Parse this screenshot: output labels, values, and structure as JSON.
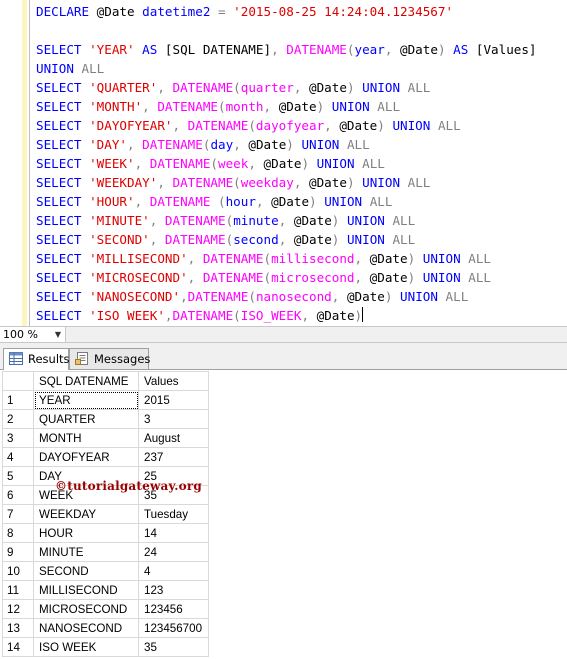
{
  "editor": {
    "lines": [
      [
        [
          "kw",
          "DECLARE "
        ],
        [
          "var",
          "@Date "
        ],
        [
          "kw",
          "datetime2 "
        ],
        [
          "op",
          "= "
        ],
        [
          "str",
          "'2015-08-25 14:24:04.1234567'"
        ]
      ],
      [],
      [
        [
          "kw",
          "SELECT "
        ],
        [
          "str",
          "'YEAR' "
        ],
        [
          "kw",
          "AS "
        ],
        [
          "plain",
          "[SQL DATENAME]"
        ],
        [
          "op",
          ", "
        ],
        [
          "fn",
          "DATENAME"
        ],
        [
          "op",
          "("
        ],
        [
          "kw",
          "year"
        ],
        [
          "op",
          ", "
        ],
        [
          "var",
          "@Date"
        ],
        [
          "op",
          ") "
        ],
        [
          "kw",
          "AS "
        ],
        [
          "plain",
          "[Values]"
        ]
      ],
      [
        [
          "kw",
          "UNION "
        ],
        [
          "op",
          "ALL"
        ]
      ],
      [
        [
          "kw",
          "SELECT "
        ],
        [
          "str",
          "'QUARTER'"
        ],
        [
          "op",
          ", "
        ],
        [
          "fn",
          "DATENAME"
        ],
        [
          "op",
          "("
        ],
        [
          "fn",
          "quarter"
        ],
        [
          "op",
          ", "
        ],
        [
          "var",
          "@Date"
        ],
        [
          "op",
          ") "
        ],
        [
          "kw",
          "UNION "
        ],
        [
          "op",
          "ALL"
        ]
      ],
      [
        [
          "kw",
          "SELECT "
        ],
        [
          "str",
          "'MONTH'"
        ],
        [
          "op",
          ", "
        ],
        [
          "fn",
          "DATENAME"
        ],
        [
          "op",
          "("
        ],
        [
          "fn",
          "month"
        ],
        [
          "op",
          ", "
        ],
        [
          "var",
          "@Date"
        ],
        [
          "op",
          ") "
        ],
        [
          "kw",
          "UNION "
        ],
        [
          "op",
          "ALL"
        ]
      ],
      [
        [
          "kw",
          "SELECT "
        ],
        [
          "str",
          "'DAYOFYEAR'"
        ],
        [
          "op",
          ", "
        ],
        [
          "fn",
          "DATENAME"
        ],
        [
          "op",
          "("
        ],
        [
          "fn",
          "dayofyear"
        ],
        [
          "op",
          ", "
        ],
        [
          "var",
          "@Date"
        ],
        [
          "op",
          ") "
        ],
        [
          "kw",
          "UNION "
        ],
        [
          "op",
          "ALL"
        ]
      ],
      [
        [
          "kw",
          "SELECT "
        ],
        [
          "str",
          "'DAY'"
        ],
        [
          "op",
          ", "
        ],
        [
          "fn",
          "DATENAME"
        ],
        [
          "op",
          "("
        ],
        [
          "kw",
          "day"
        ],
        [
          "op",
          ", "
        ],
        [
          "var",
          "@Date"
        ],
        [
          "op",
          ") "
        ],
        [
          "kw",
          "UNION "
        ],
        [
          "op",
          "ALL"
        ]
      ],
      [
        [
          "kw",
          "SELECT "
        ],
        [
          "str",
          "'WEEK'"
        ],
        [
          "op",
          ", "
        ],
        [
          "fn",
          "DATENAME"
        ],
        [
          "op",
          "("
        ],
        [
          "fn",
          "week"
        ],
        [
          "op",
          ", "
        ],
        [
          "var",
          "@Date"
        ],
        [
          "op",
          ") "
        ],
        [
          "kw",
          "UNION "
        ],
        [
          "op",
          "ALL"
        ]
      ],
      [
        [
          "kw",
          "SELECT "
        ],
        [
          "str",
          "'WEEKDAY'"
        ],
        [
          "op",
          ", "
        ],
        [
          "fn",
          "DATENAME"
        ],
        [
          "op",
          "("
        ],
        [
          "fn",
          "weekday"
        ],
        [
          "op",
          ", "
        ],
        [
          "var",
          "@Date"
        ],
        [
          "op",
          ") "
        ],
        [
          "kw",
          "UNION "
        ],
        [
          "op",
          "ALL"
        ]
      ],
      [
        [
          "kw",
          "SELECT "
        ],
        [
          "str",
          "'HOUR'"
        ],
        [
          "op",
          ", "
        ],
        [
          "fn",
          "DATENAME "
        ],
        [
          "op",
          "("
        ],
        [
          "kw",
          "hour"
        ],
        [
          "op",
          ", "
        ],
        [
          "var",
          "@Date"
        ],
        [
          "op",
          ") "
        ],
        [
          "kw",
          "UNION "
        ],
        [
          "op",
          "ALL"
        ]
      ],
      [
        [
          "kw",
          "SELECT "
        ],
        [
          "str",
          "'MINUTE'"
        ],
        [
          "op",
          ", "
        ],
        [
          "fn",
          "DATENAME"
        ],
        [
          "op",
          "("
        ],
        [
          "kw",
          "minute"
        ],
        [
          "op",
          ", "
        ],
        [
          "var",
          "@Date"
        ],
        [
          "op",
          ") "
        ],
        [
          "kw",
          "UNION "
        ],
        [
          "op",
          "ALL"
        ]
      ],
      [
        [
          "kw",
          "SELECT "
        ],
        [
          "str",
          "'SECOND'"
        ],
        [
          "op",
          ", "
        ],
        [
          "fn",
          "DATENAME"
        ],
        [
          "op",
          "("
        ],
        [
          "kw",
          "second"
        ],
        [
          "op",
          ", "
        ],
        [
          "var",
          "@Date"
        ],
        [
          "op",
          ") "
        ],
        [
          "kw",
          "UNION "
        ],
        [
          "op",
          "ALL"
        ]
      ],
      [
        [
          "kw",
          "SELECT "
        ],
        [
          "str",
          "'MILLISECOND'"
        ],
        [
          "op",
          ", "
        ],
        [
          "fn",
          "DATENAME"
        ],
        [
          "op",
          "("
        ],
        [
          "fn",
          "millisecond"
        ],
        [
          "op",
          ", "
        ],
        [
          "var",
          "@Date"
        ],
        [
          "op",
          ") "
        ],
        [
          "kw",
          "UNION "
        ],
        [
          "op",
          "ALL"
        ]
      ],
      [
        [
          "kw",
          "SELECT "
        ],
        [
          "str",
          "'MICROSECOND'"
        ],
        [
          "op",
          ", "
        ],
        [
          "fn",
          "DATENAME"
        ],
        [
          "op",
          "("
        ],
        [
          "fn",
          "microsecond"
        ],
        [
          "op",
          ", "
        ],
        [
          "var",
          "@Date"
        ],
        [
          "op",
          ") "
        ],
        [
          "kw",
          "UNION "
        ],
        [
          "op",
          "ALL"
        ]
      ],
      [
        [
          "kw",
          "SELECT "
        ],
        [
          "str",
          "'NANOSECOND'"
        ],
        [
          "op",
          ","
        ],
        [
          "fn",
          "DATENAME"
        ],
        [
          "op",
          "("
        ],
        [
          "fn",
          "nanosecond"
        ],
        [
          "op",
          ", "
        ],
        [
          "var",
          "@Date"
        ],
        [
          "op",
          ") "
        ],
        [
          "kw",
          "UNION "
        ],
        [
          "op",
          "ALL"
        ]
      ],
      [
        [
          "kw",
          "SELECT "
        ],
        [
          "str",
          "'ISO WEEK'"
        ],
        [
          "op",
          ","
        ],
        [
          "fn",
          "DATENAME"
        ],
        [
          "op",
          "("
        ],
        [
          "fn",
          "ISO_WEEK"
        ],
        [
          "op",
          ", "
        ],
        [
          "var",
          "@Date"
        ],
        [
          "op",
          ")"
        ]
      ]
    ]
  },
  "zoom": {
    "value": "100 %"
  },
  "tabs": [
    {
      "label": "Results",
      "icon": "results-grid-icon",
      "active": true
    },
    {
      "label": "Messages",
      "icon": "messages-icon",
      "active": false
    }
  ],
  "grid": {
    "columns": [
      "SQL DATENAME",
      "Values"
    ],
    "rows": [
      [
        "1",
        "YEAR",
        "2015"
      ],
      [
        "2",
        "QUARTER",
        "3"
      ],
      [
        "3",
        "MONTH",
        "August"
      ],
      [
        "4",
        "DAYOFYEAR",
        "237"
      ],
      [
        "5",
        "DAY",
        "25"
      ],
      [
        "6",
        "WEEK",
        "35"
      ],
      [
        "7",
        "WEEKDAY",
        "Tuesday"
      ],
      [
        "8",
        "HOUR",
        "14"
      ],
      [
        "9",
        "MINUTE",
        "24"
      ],
      [
        "10",
        "SECOND",
        "4"
      ],
      [
        "11",
        "MILLISECOND",
        "123"
      ],
      [
        "12",
        "MICROSECOND",
        "123456"
      ],
      [
        "13",
        "NANOSECOND",
        "123456700"
      ],
      [
        "14",
        "ISO WEEK",
        "35"
      ]
    ]
  },
  "watermark": {
    "text": "©tutorialgateway.org"
  },
  "colors": {
    "keyword": "#0000ff",
    "string": "#e00000",
    "function": "#ff00ff",
    "operator": "#808080",
    "watermark": "#9b0000"
  }
}
